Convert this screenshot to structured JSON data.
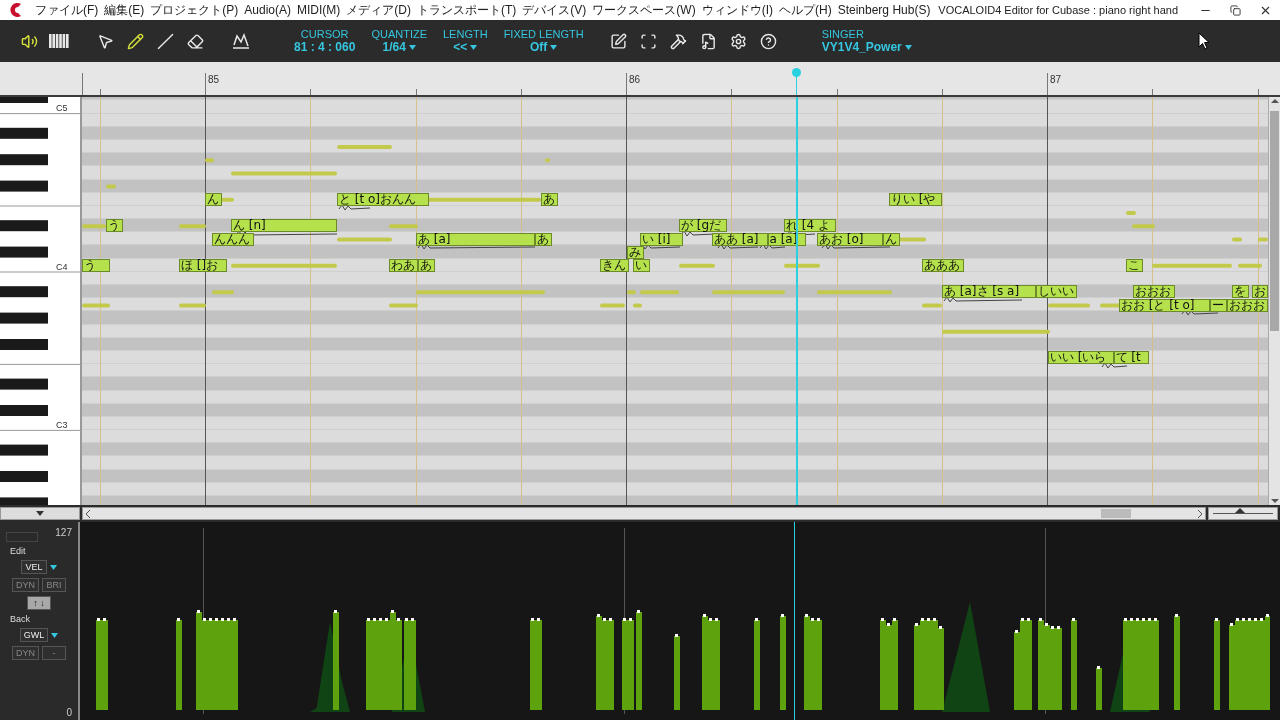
{
  "window": {
    "title": "VOCALOID4 Editor for Cubase : piano right hand"
  },
  "menu": [
    "ファイル(F)",
    "編集(E)",
    "プロジェクト(P)",
    "Audio(A)",
    "MIDI(M)",
    "メディア(D)",
    "トランスポート(T)",
    "デバイス(V)",
    "ワークスペース(W)",
    "ウィンドウ(I)",
    "ヘルプ(H)",
    "Steinberg Hub(S)"
  ],
  "toolbar": {
    "modes": [
      {
        "kind": "speaker",
        "selected": true
      },
      {
        "kind": "keyboard",
        "selected": false
      }
    ],
    "tools": [
      {
        "kind": "arrow",
        "selected": false
      },
      {
        "kind": "pencil",
        "selected": true
      },
      {
        "kind": "line",
        "selected": false
      },
      {
        "kind": "eraser",
        "selected": false
      },
      {
        "kind": "curve",
        "selected": false
      }
    ],
    "fields": [
      {
        "label": "CURSOR",
        "value": "81 : 4 : 060",
        "dropdown": false
      },
      {
        "label": "QUANTIZE",
        "value": "1/64",
        "dropdown": true
      },
      {
        "label": "LENGTH",
        "value": "<<",
        "dropdown": true
      },
      {
        "label": "FIXED LENGTH",
        "value": "Off",
        "dropdown": true
      }
    ],
    "actions": [
      {
        "kind": "edit"
      },
      {
        "kind": "fit"
      },
      {
        "kind": "hammer"
      },
      {
        "kind": "score"
      },
      {
        "kind": "settings"
      },
      {
        "kind": "help"
      }
    ],
    "singer": {
      "label": "SINGER",
      "value": "VY1V4_Power",
      "dropdown": true
    }
  },
  "ruler": {
    "bars": [
      "85",
      "86",
      "87"
    ]
  },
  "keyboard": {
    "labels": [
      "C5",
      "C4",
      "C3"
    ]
  },
  "zoom": {
    "level": 0.45
  },
  "notes": [
    {
      "lyric": "ん"
    },
    {
      "lyric": "と [t o]おんん"
    },
    {
      "lyric": "あ"
    },
    {
      "lyric": "りい [や"
    },
    {
      "lyric": "う"
    },
    {
      "lyric": "ん [n]"
    },
    {
      "lyric": "が [gだ"
    },
    {
      "lyric": "れ [4 よ"
    },
    {
      "lyric": "んんん"
    },
    {
      "lyric": "あ [a]"
    },
    {
      "lyric": "あ"
    },
    {
      "lyric": "い [i]"
    },
    {
      "lyric": "ああ [a]"
    },
    {
      "lyric": "a [a]"
    },
    {
      "lyric": "あお [o]"
    },
    {
      "lyric": "ん"
    },
    {
      "lyric": "み"
    },
    {
      "lyric": "う"
    },
    {
      "lyric": "ほ []お"
    },
    {
      "lyric": "わあ"
    },
    {
      "lyric": "あ"
    },
    {
      "lyric": "きん"
    },
    {
      "lyric": "い"
    },
    {
      "lyric": "あああ"
    },
    {
      "lyric": "こ"
    },
    {
      "lyric": "あ [a]さ [s a]"
    },
    {
      "lyric": "しいい"
    },
    {
      "lyric": "おおお"
    },
    {
      "lyric": "を"
    },
    {
      "lyric": "お"
    },
    {
      "lyric": "おお [と [t o]"
    },
    {
      "lyric": "ー"
    },
    {
      "lyric": "おおお"
    },
    {
      "lyric": "いい [いら"
    },
    {
      "lyric": "て [t"
    }
  ],
  "control_panel": {
    "max": "127",
    "min": "0",
    "edit_label": "Edit",
    "edit_param": "VEL",
    "edit_buttons": [
      {
        "label": "DYN",
        "disabled": true
      },
      {
        "label": "BRI",
        "disabled": true
      }
    ],
    "swap_button": "↑ ↓",
    "back_label": "Back",
    "back_param": "GWL",
    "back_buttons": [
      {
        "label": "DYN",
        "disabled": true
      },
      {
        "label": "-",
        "disabled": true
      }
    ]
  }
}
